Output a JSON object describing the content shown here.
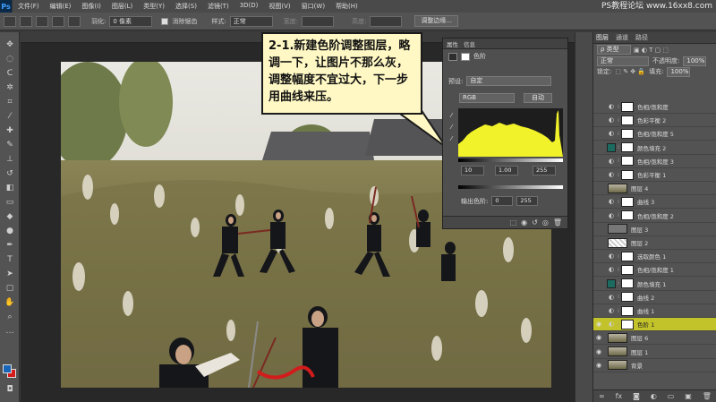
{
  "app": {
    "logo": "Ps"
  },
  "menu": [
    "文件(F)",
    "编辑(E)",
    "图像(I)",
    "图层(L)",
    "类型(Y)",
    "选择(S)",
    "滤镜(T)",
    "3D(D)",
    "视图(V)",
    "窗口(W)",
    "帮助(H)"
  ],
  "watermark": "PS教程论坛 www.16xx8.com",
  "options": {
    "feather_label": "羽化:",
    "feather_value": "0 像素",
    "antialias_label": "消除锯齿",
    "style_label": "样式:",
    "style_value": "正常",
    "width_label": "宽度:",
    "height_label": "高度:",
    "refine_button": "调整边缘..."
  },
  "callout": {
    "text": "2-1.新建色阶调整图层，略调一下，让图片不那么灰，调整幅度不宜过大，下一步用曲线来压。"
  },
  "properties": {
    "tab1": "属性",
    "tab2": "信息",
    "title": "色阶",
    "preset_label": "预设:",
    "preset_value": "自定",
    "channel_value": "RGB",
    "auto_button": "自动",
    "input_black": "10",
    "input_gamma": "1.00",
    "input_white": "255",
    "output_label": "输出色阶:",
    "output_black": "0",
    "output_white": "255"
  },
  "layers": {
    "tabs": [
      "图层",
      "通道",
      "路径"
    ],
    "kind_value": "ρ 类型",
    "blend_mode": "正常",
    "opacity_label": "不透明度:",
    "opacity_value": "100%",
    "lock_label": "锁定:",
    "fill_label": "填充:",
    "fill_value": "100%",
    "items": [
      {
        "name": "色相/饱和度",
        "kind": "adj",
        "visible": false,
        "selected": false
      },
      {
        "name": "色彩平衡 2",
        "kind": "adj",
        "visible": false,
        "selected": false
      },
      {
        "name": "色相/饱和度 5",
        "kind": "adj",
        "visible": false,
        "selected": false
      },
      {
        "name": "颜色填充 2",
        "kind": "fill",
        "visible": false,
        "selected": false
      },
      {
        "name": "色相/饱和度 3",
        "kind": "adj",
        "visible": false,
        "selected": false
      },
      {
        "name": "色彩平衡 1",
        "kind": "adj",
        "visible": false,
        "selected": false
      },
      {
        "name": "图层 4",
        "kind": "pixel",
        "visible": false,
        "selected": false
      },
      {
        "name": "曲线 3",
        "kind": "adj",
        "visible": false,
        "selected": false
      },
      {
        "name": "色相/饱和度 2",
        "kind": "adj",
        "visible": false,
        "selected": false
      },
      {
        "name": "图层 3",
        "kind": "pixel-empty",
        "visible": false,
        "selected": false
      },
      {
        "name": "图层 2",
        "kind": "pixel-checker",
        "visible": false,
        "selected": false
      },
      {
        "name": "选取颜色 1",
        "kind": "adj",
        "visible": false,
        "selected": false
      },
      {
        "name": "色相/饱和度 1",
        "kind": "adj",
        "visible": false,
        "selected": false
      },
      {
        "name": "颜色填充 1",
        "kind": "fill",
        "visible": false,
        "selected": false
      },
      {
        "name": "曲线 2",
        "kind": "adj",
        "visible": false,
        "selected": false
      },
      {
        "name": "曲线 1",
        "kind": "adj",
        "visible": false,
        "selected": false
      },
      {
        "name": "色阶 1",
        "kind": "adj",
        "visible": true,
        "selected": true
      },
      {
        "name": "图层 6",
        "kind": "pixel",
        "visible": true,
        "selected": false
      },
      {
        "name": "图层 1",
        "kind": "pixel",
        "visible": true,
        "selected": false
      },
      {
        "name": "背景",
        "kind": "pixel",
        "visible": true,
        "selected": false
      }
    ]
  },
  "colors": {
    "foreground": "#1966b8",
    "background": "#d51c1c",
    "selection": "#c2c22a",
    "fill_layer_color": "#1b6b60"
  }
}
